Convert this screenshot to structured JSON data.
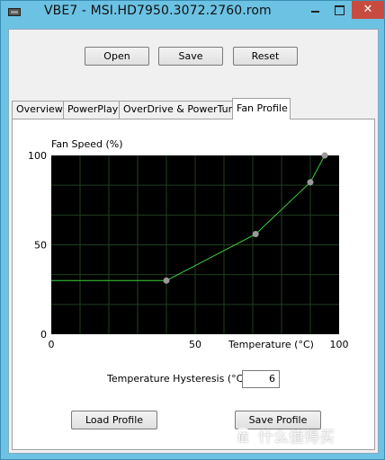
{
  "window": {
    "title": "VBE7 - MSI.HD7950.3072.2760.rom",
    "close_glyph": "✕"
  },
  "toolbar": {
    "open_label": "Open",
    "save_label": "Save",
    "reset_label": "Reset"
  },
  "tabs": [
    {
      "label": "Overview",
      "active": false
    },
    {
      "label": "PowerPlay",
      "active": false
    },
    {
      "label": "OverDrive & PowerTune",
      "active": false
    },
    {
      "label": "Fan Profile",
      "active": true
    }
  ],
  "fan_profile": {
    "hysteresis_label": "Temperature Hysteresis (°C)",
    "hysteresis_value": "6",
    "load_label": "Load Profile",
    "save_label": "Save Profile"
  },
  "chart_data": {
    "type": "line",
    "ylabel": "Fan Speed (%)",
    "xlabel": "Temperature (°C)",
    "xlim": [
      0,
      100
    ],
    "ylim": [
      0,
      100
    ],
    "x_ticks": [
      "0",
      "50",
      "100"
    ],
    "y_ticks": [
      "100",
      "50",
      "0"
    ],
    "grid": true,
    "background": "#000000",
    "grid_color": "#1f3f1f",
    "line_color": "#3ad13a",
    "point_color": "#9a9a9a",
    "baseline": {
      "x": [
        0,
        40
      ],
      "y": [
        30,
        30
      ]
    },
    "points": [
      {
        "x": 40,
        "y": 30
      },
      {
        "x": 71,
        "y": 56
      },
      {
        "x": 90,
        "y": 85
      },
      {
        "x": 95,
        "y": 100
      }
    ]
  },
  "watermark": {
    "mark": "值",
    "text": "什么值得买"
  }
}
